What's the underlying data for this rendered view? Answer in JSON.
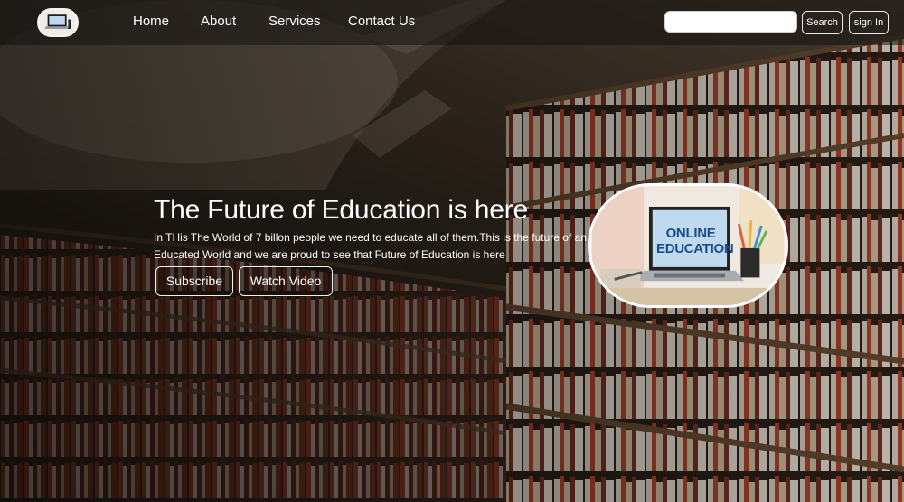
{
  "nav": {
    "links": [
      "Home",
      "About",
      "Services",
      "Contact Us"
    ],
    "search_placeholder": "",
    "search_label": "Search",
    "signin_label": "sign In"
  },
  "hero": {
    "title": "The Future of Education is here",
    "text": "In THis The World of 7 billon people we need to educate all of them.This is the future of an Educated World and we are proud to see that Future of Education is here",
    "subscribe_label": "Subscribe",
    "watch_label": "Watch Video",
    "image_text_line1": "ONLINE",
    "image_text_line2": "EDUCATION"
  },
  "logo": {
    "text": "ONLINE EDUCATION"
  }
}
